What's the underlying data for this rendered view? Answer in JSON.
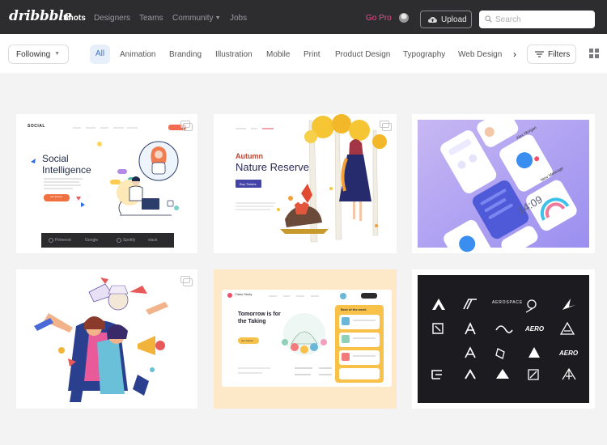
{
  "brand": {
    "logo": "dribbble"
  },
  "nav": {
    "links": [
      "Shots",
      "Designers",
      "Teams",
      "Community",
      "Jobs"
    ],
    "go_pro": "Go Pro",
    "upload": "Upload",
    "search_placeholder": "Search"
  },
  "filters": {
    "following": "Following",
    "categories": [
      "All",
      "Animation",
      "Branding",
      "Illustration",
      "Mobile",
      "Print",
      "Product Design",
      "Typography",
      "Web Design"
    ],
    "filters_label": "Filters"
  },
  "shots": {
    "social": {
      "brand": "SOCIAL",
      "headline1": "Social",
      "headline2": "Intelligence",
      "cta": "Get started",
      "logos": [
        "Pinterest",
        "Google",
        "Spotify",
        "slack"
      ]
    },
    "autumn": {
      "title1": "Autumn",
      "title2": "Nature Reserve",
      "cta": "Buy Tickets"
    },
    "mobile": {
      "time": "14:09",
      "user": "Alex Morgan",
      "message": "New Message"
    },
    "learning": {
      "title1": "Tomorrow is for",
      "title2": "the Taking",
      "cta": "Get started",
      "side_title": "Best of the week",
      "brand": "Class Study"
    },
    "logos": {
      "marks": [
        "AEROSPACE",
        "AERO",
        "AERO"
      ]
    }
  },
  "colors": {
    "accent_pink": "#ea4c89",
    "nav_bg": "#2d2d2f",
    "active_chip_bg": "#e7effb",
    "active_chip_text": "#3d72ce"
  }
}
